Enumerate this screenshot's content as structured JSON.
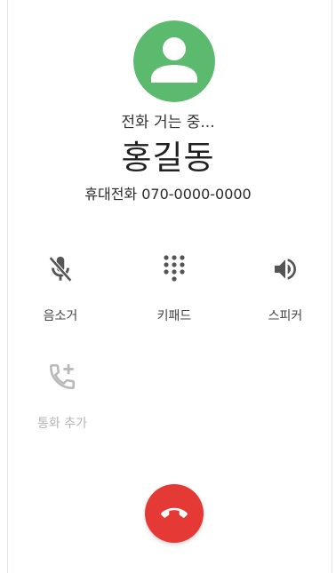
{
  "call": {
    "status": "전화 거는 중...",
    "caller_name": "홍길동",
    "caller_number": "휴대전화 070-0000-0000"
  },
  "actions": {
    "mute": {
      "label": "음소거",
      "icon": "mic-off-icon",
      "enabled": true
    },
    "keypad": {
      "label": "키패드",
      "icon": "dialpad-icon",
      "enabled": true
    },
    "speaker": {
      "label": "스피커",
      "icon": "volume-icon",
      "enabled": true
    },
    "add_call": {
      "label": "통화 추가",
      "icon": "add-call-icon",
      "enabled": false
    }
  },
  "end_call": {
    "icon": "call-end-icon"
  },
  "colors": {
    "avatar_bg": "#5cba6f",
    "end_call_bg": "#e53935",
    "icon_active": "#555555",
    "icon_disabled": "#b8b8b8"
  }
}
